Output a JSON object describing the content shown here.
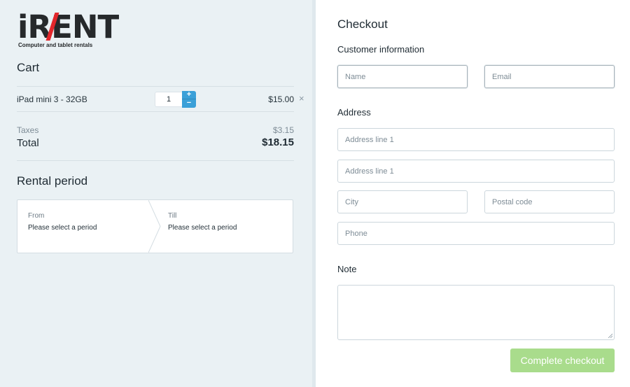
{
  "brand": {
    "logo_text": "iRENT",
    "tagline": "Computer and tablet rentals",
    "accent": "#e2262b"
  },
  "cart": {
    "title": "Cart",
    "items": [
      {
        "name": "iPad mini 3 - 32GB",
        "quantity": "1",
        "price": "$15.00",
        "increment_label": "+",
        "decrement_label": "−",
        "remove_label": "×"
      }
    ],
    "taxes_label": "Taxes",
    "taxes_value": "$3.15",
    "total_label": "Total",
    "total_value": "$18.15"
  },
  "rental": {
    "title": "Rental period",
    "from_label": "From",
    "from_value": "Please select a period",
    "till_label": "Till",
    "till_value": "Please select a period"
  },
  "checkout": {
    "title": "Checkout",
    "customer_title": "Customer information",
    "name_placeholder": "Name",
    "email_placeholder": "Email",
    "address_title": "Address",
    "address1_placeholder": "Address line 1",
    "address2_placeholder": "Address line 1",
    "city_placeholder": "City",
    "postal_placeholder": "Postal code",
    "phone_placeholder": "Phone",
    "note_title": "Note",
    "note_value": "",
    "complete_label": "Complete checkout",
    "complete_color": "#a9dc8c"
  },
  "colors": {
    "left_panel_bg": "#eaf1f4",
    "qty_button": "#3aa0d8"
  },
  "icons": {
    "remove": "close-icon",
    "increment": "plus-icon",
    "decrement": "minus-icon",
    "resize": "resize-grip-icon"
  }
}
